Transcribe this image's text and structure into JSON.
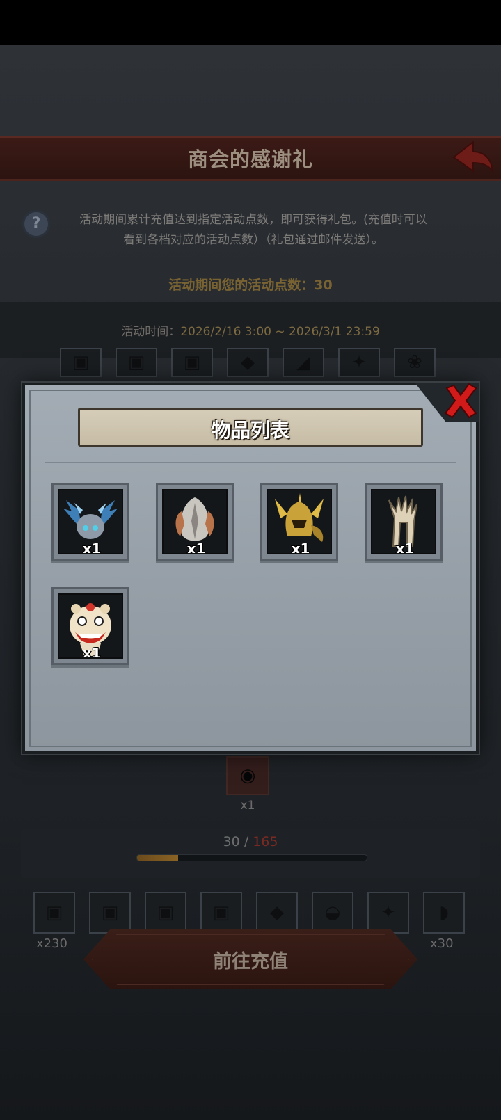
{
  "screen": {
    "title": "商会的感谢礼",
    "description_line1": "活动期间累计充值达到指定活动点数，即可获得礼包。(充值时可以",
    "description_line2": "看到各档对应的活动点数）（礼包通过邮件发送）。",
    "points_label": "活动期间您的活动点数：",
    "points_value": "30",
    "time_label": "活动时间：",
    "time_value": "2026/2/16 3:00 ~ 2026/3/1 23:59"
  },
  "background_items": {
    "single_quantity": "x1",
    "progress": {
      "current": "30",
      "separator": " / ",
      "max": "165",
      "fraction": 0.18
    },
    "reward_row_quantities": {
      "first": "x230",
      "last": "x30"
    },
    "recharge_button_label": "前往充值"
  },
  "modal": {
    "title": "物品列表",
    "items": [
      {
        "icon": "crystal-winged-helmet-icon",
        "quantity": "x1"
      },
      {
        "icon": "silver-flame-helmet-icon",
        "quantity": "x1"
      },
      {
        "icon": "golden-horned-helmet-icon",
        "quantity": "x1"
      },
      {
        "icon": "bone-antler-crown-icon",
        "quantity": "x1"
      },
      {
        "icon": "lion-dance-head-icon",
        "quantity": "x1"
      }
    ]
  },
  "colors": {
    "banner_red": "#3c1a16",
    "accent_gold": "#7a6332",
    "progress_max_red": "#7a2a22",
    "close_red": "#d11a1a",
    "modal_bg": "#9aa3ab"
  }
}
